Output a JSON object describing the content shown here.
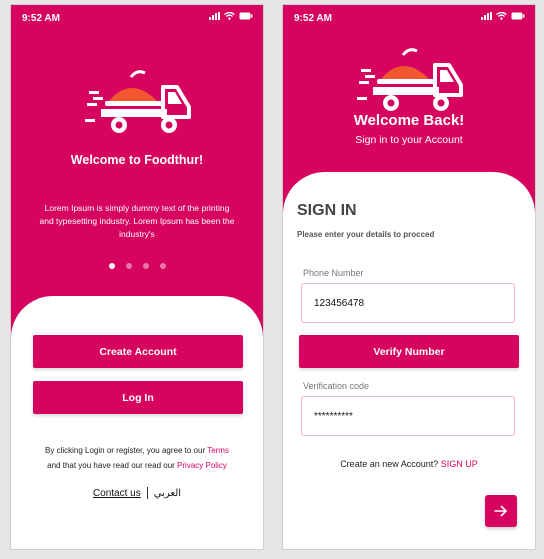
{
  "colors": {
    "brand": "#d6045f",
    "sheet": "#ffffff",
    "canvas": "#e6e6e6"
  },
  "icons": [
    "food-truck-logo-icon",
    "signal-icon",
    "wifi-icon",
    "battery-icon",
    "arrow-right-icon"
  ],
  "onboarding": {
    "status_time": "9:52 AM",
    "title": "Welcome to Foodthur!",
    "description": "Lorem Ipsum is simply dummy text of the printing and typesetting industry. Lorem Ipsum has been the industry's",
    "page_count": 4,
    "active_page": 1,
    "create_account_label": "Create Account",
    "login_label": "Log In",
    "terms_prefix": "By clicking Login or register, you agree to our",
    "terms_link": "Terms",
    "terms_middle": "and that you have read our read our",
    "privacy_link": "Privacy Policy",
    "contact_label": "Contact us",
    "language_label": "العربي"
  },
  "signin": {
    "status_time": "9:52 AM",
    "title": "Welcome Back!",
    "subtitle": "Sign in to your Account",
    "heading": "SIGN IN",
    "instructions": "Please enter your details to procced",
    "phone_label": "Phone Number",
    "phone_value": "123456478",
    "verify_label": "Verify Number",
    "code_label": "Verification code",
    "code_value": "**********",
    "create_prompt": "Create an new Account?",
    "signup_link": "SIGN UP"
  }
}
